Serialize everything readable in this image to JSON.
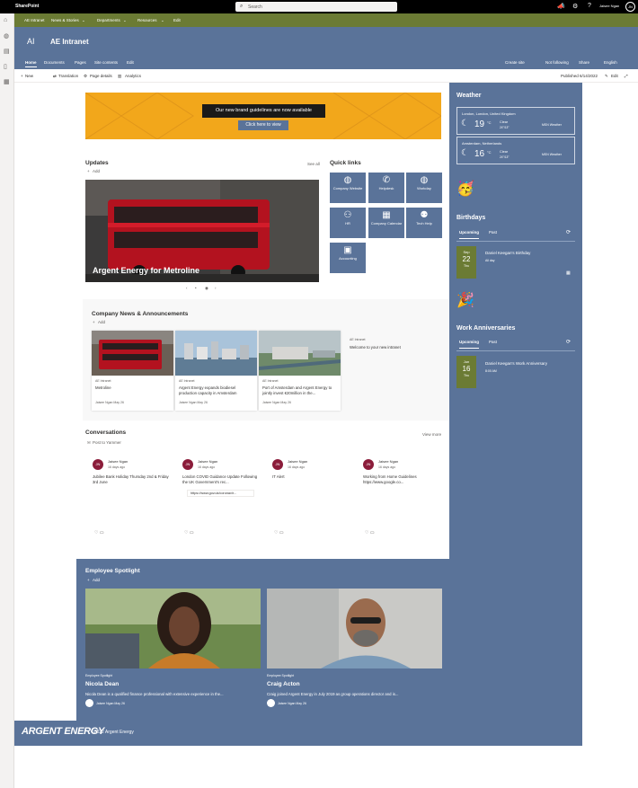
{
  "suite": {
    "brand": "SharePoint",
    "search_placeholder": "Search",
    "user_name": "Jaisee Ngan",
    "user_initials": "JN"
  },
  "hub_nav": {
    "items": [
      "AE Intranet",
      "News & Stories",
      "Departments",
      "Resources",
      "Edit"
    ]
  },
  "site": {
    "logo_text": "AI",
    "title": "AE Intranet",
    "nav": [
      "Home",
      "Documents",
      "Pages",
      "Site contents",
      "Edit"
    ],
    "actions": [
      "Create site",
      "Not following",
      "Share",
      "English"
    ]
  },
  "command_bar": {
    "new": "New",
    "translation": "Translation",
    "page_details": "Page details",
    "analytics": "Analytics",
    "published": "Published 6/14/2022",
    "edit": "Edit"
  },
  "banner": {
    "message": "Our new brand guidelines are now available",
    "button": "Click here to view"
  },
  "updates": {
    "title": "Updates",
    "add": "Add",
    "see_all": "See all",
    "hero_caption": "Argent Energy for Metroline"
  },
  "quick_links": {
    "title": "Quick links",
    "items": [
      {
        "label": "Company Website",
        "icon": "globe-icon"
      },
      {
        "label": "Helpdesk",
        "icon": "phone-icon"
      },
      {
        "label": "Workday",
        "icon": "globe-icon"
      },
      {
        "label": "HR",
        "icon": "people-icon"
      },
      {
        "label": "Company Calendar",
        "icon": "calendar-icon"
      },
      {
        "label": "Tech Help",
        "icon": "person-help-icon"
      },
      {
        "label": "Accounting",
        "icon": "money-icon"
      }
    ]
  },
  "news": {
    "title": "Company News & Announcements",
    "add": "Add",
    "cards": [
      {
        "site": "AE Intranet",
        "title": "Metroline",
        "meta": "Jaisee Ngan  May 26"
      },
      {
        "site": "AE Intranet",
        "title": "Argent Energy expands biodiesel production capacity in Amsterdam",
        "meta": "Jaisee Ngan  May 26"
      },
      {
        "site": "AE Intranet",
        "title": "Port of Amsterdam and Argent Energy to jointly invest €20million in the...",
        "meta": "Jaisee Ngan  May 26"
      },
      {
        "site": "AE Intranet",
        "title": "Welcome to your new intranet",
        "meta": ""
      }
    ]
  },
  "conversations": {
    "title": "Conversations",
    "post": "Post to Yammer",
    "view_more": "View more",
    "posts": [
      {
        "initials": "JN",
        "name": "Jaisee Ngan",
        "date": "16 days ago",
        "text": "Jubilee Bank Holiday Thursday 2nd & Friday 3rd June",
        "link": ""
      },
      {
        "initials": "JN",
        "name": "Jaisee Ngan",
        "date": "16 days ago",
        "text": "London COVID Guidance Update Following the UK Government's rec...",
        "link": "https://www.gov.uk/coronavir..."
      },
      {
        "initials": "JN",
        "name": "Jaisee Ngan",
        "date": "16 days ago",
        "text": "IT Alert",
        "link": ""
      },
      {
        "initials": "JN",
        "name": "Jaisee Ngan",
        "date": "16 days ago",
        "text": "Working from Home Guidelines https://www.google.co...",
        "link": ""
      }
    ]
  },
  "weather": {
    "title": "Weather",
    "cards": [
      {
        "location": "London, London, United Kingdom",
        "temp": "19",
        "unit": "°C",
        "condition": "Clear",
        "hilo": "24°/13°",
        "source": "MSN Weather"
      },
      {
        "location": "Amsterdam, Netherlands",
        "temp": "16",
        "unit": "°C",
        "condition": "Clear",
        "hilo": "24°/13°",
        "source": "MSN Weather"
      }
    ]
  },
  "birthdays": {
    "title": "Birthdays",
    "tab_upcoming": "Upcoming",
    "tab_past": "Past",
    "month": "Sep",
    "day": "22",
    "weekday": "Thu",
    "event": "Daniel Keegan's Birthday",
    "sub": "All day"
  },
  "anniversaries": {
    "title": "Work Anniversaries",
    "tab_upcoming": "Upcoming",
    "tab_past": "Past",
    "month": "Jun",
    "day": "16",
    "weekday": "Thu",
    "event": "Daniel Keegan's Work Anniversary",
    "sub": "8:00 AM"
  },
  "spotlight": {
    "title": "Employee Spotlight",
    "add": "Add",
    "cards": [
      {
        "tag": "Employee Spotlight",
        "name": "Nicola Dean",
        "desc": "Nicola Dean is a qualified finance professional with extensive experience in the...",
        "meta": "Jaisee Ngan  May 26"
      },
      {
        "tag": "Employee Spotlight",
        "name": "Craig Acton",
        "desc": "Craig joined Argent Energy in July 2019 as group operations director and is...",
        "meta": "Jaisee Ngan  May 26"
      }
    ]
  },
  "footer": {
    "logo": "ARGENT ENERGY",
    "copyright": "©2022 Argent Energy"
  },
  "colors": {
    "theme": "#5a7399",
    "hub": "#6b7b34",
    "banner": "#f2a71b"
  }
}
